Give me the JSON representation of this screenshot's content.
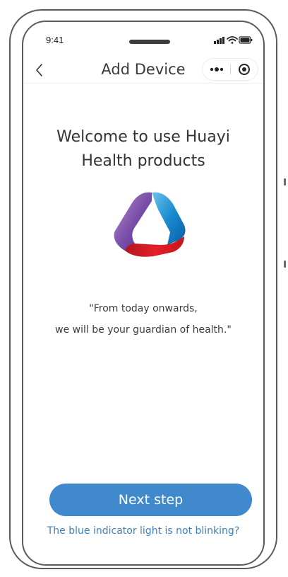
{
  "status_bar": {
    "time": "9:41",
    "icons": [
      "signal-icon",
      "wifi-icon",
      "battery-icon"
    ]
  },
  "nav": {
    "title": "Add Device",
    "back_icon": "chevron-left-icon",
    "capsule_icons": [
      "more-dots-icon",
      "target-close-icon"
    ]
  },
  "welcome": {
    "title_line1": "Welcome to use Huayi",
    "title_line2": "Health products",
    "logo_icon": "huayi-logo-icon"
  },
  "slogan": {
    "line1": "\"From today onwards,",
    "line2": "we will be your guardian of health.\""
  },
  "actions": {
    "next_label": "Next step",
    "help_link": "The blue indicator light is not blinking?"
  },
  "colors": {
    "accent": "#3f89cc",
    "link": "#3d82c0",
    "text": "#333333"
  }
}
